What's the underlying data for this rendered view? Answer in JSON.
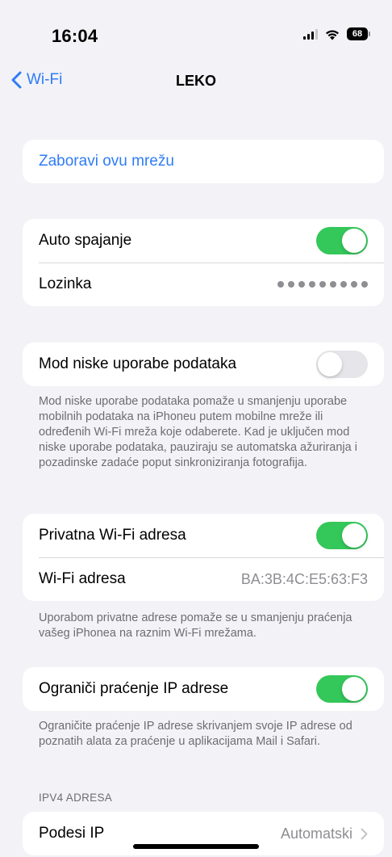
{
  "status_bar": {
    "time": "16:04",
    "battery": "68"
  },
  "nav": {
    "back_label": "Wi-Fi",
    "title": "LEKO"
  },
  "forget": {
    "label": "Zaboravi ovu mrežu"
  },
  "connection": {
    "auto_join_label": "Auto spajanje",
    "auto_join_on": true,
    "password_label": "Lozinka",
    "password_mask_length": 9
  },
  "low_data": {
    "label": "Mod niske uporabe podataka",
    "on": false,
    "footnote": "Mod niske uporabe podataka pomaže u smanjenju uporabe mobilnih podataka na iPhoneu putem mobilne mreže ili određenih Wi-Fi mreža koje odaberete. Kad je uključen mod niske uporabe podataka, pauziraju se automatska ažuriranja i pozadinske zadaće poput sinkroniziranja fotografija."
  },
  "private_address": {
    "label": "Privatna Wi-Fi adresa",
    "on": true,
    "address_label": "Wi-Fi adresa",
    "address_value": "BA:3B:4C:E5:63:F3",
    "footnote": "Uporabom privatne adrese pomaže se u smanjenju praćenja vašeg iPhonea na raznim Wi-Fi mrežama."
  },
  "ip_tracking": {
    "label": "Ograniči praćenje IP adrese",
    "on": true,
    "footnote": "Ograničite praćenje IP adrese skrivanjem svoje IP adrese od poznatih alata za praćenje u aplikacijama Mail i Safari."
  },
  "ipv4": {
    "header": "IPV4 ADRESA",
    "configure_label": "Podesi IP",
    "configure_value": "Automatski"
  },
  "colors": {
    "accent": "#2f7cf6",
    "toggle_on": "#34c759",
    "toggle_off": "#e5e5ea",
    "background": "#f2f2f7"
  }
}
